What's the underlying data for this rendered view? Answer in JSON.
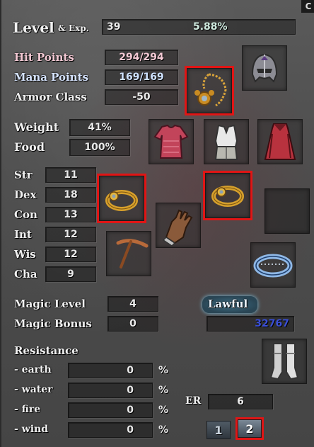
{
  "header": {
    "level_label": "Level",
    "exp_label": "& Exp.",
    "level": "39",
    "exp": "5.88%",
    "corner": "C"
  },
  "vitals": {
    "hp_label": "Hit Points",
    "hp_value": "294/294",
    "mp_label": "Mana Points",
    "mp_value": "169/169",
    "ac_label": "Armor Class",
    "ac_value": "-50"
  },
  "load": {
    "weight_label": "Weight",
    "weight_value": "41%",
    "food_label": "Food",
    "food_value": "100%"
  },
  "stats": [
    {
      "label": "Str",
      "value": "11"
    },
    {
      "label": "Dex",
      "value": "18"
    },
    {
      "label": "Con",
      "value": "13"
    },
    {
      "label": "Int",
      "value": "12"
    },
    {
      "label": "Wis",
      "value": "12"
    },
    {
      "label": "Cha",
      "value": "9"
    }
  ],
  "magic": {
    "level_label": "Magic Level",
    "level_value": "4",
    "bonus_label": "Magic Bonus",
    "bonus_value": "0"
  },
  "alignment": {
    "label": "Lawful",
    "value": "32767"
  },
  "resistance": {
    "title": "Resistance",
    "items": [
      {
        "label": "- earth",
        "value": "0",
        "unit": "%"
      },
      {
        "label": "- water",
        "value": "0",
        "unit": "%"
      },
      {
        "label": "- fire",
        "value": "0",
        "unit": "%"
      },
      {
        "label": "- wind",
        "value": "0",
        "unit": "%"
      }
    ]
  },
  "er": {
    "label": "ER",
    "value": "6"
  },
  "tabs": [
    {
      "label": "1"
    },
    {
      "label": "2"
    }
  ],
  "equipment_icons": [
    "helmet-icon",
    "necklace-icon",
    "shirt-icon",
    "armor-vest-icon",
    "cloak-icon",
    "ring-icon",
    "ring-icon",
    "glove-icon",
    "pickaxe-icon",
    "bracelet-ring-icon",
    "boots-icon"
  ],
  "colors": {
    "highlight": "#e01515",
    "alignment_value": "#3a4fd6",
    "hp": "#f3c9d4",
    "mp": "#cfe2ff"
  }
}
